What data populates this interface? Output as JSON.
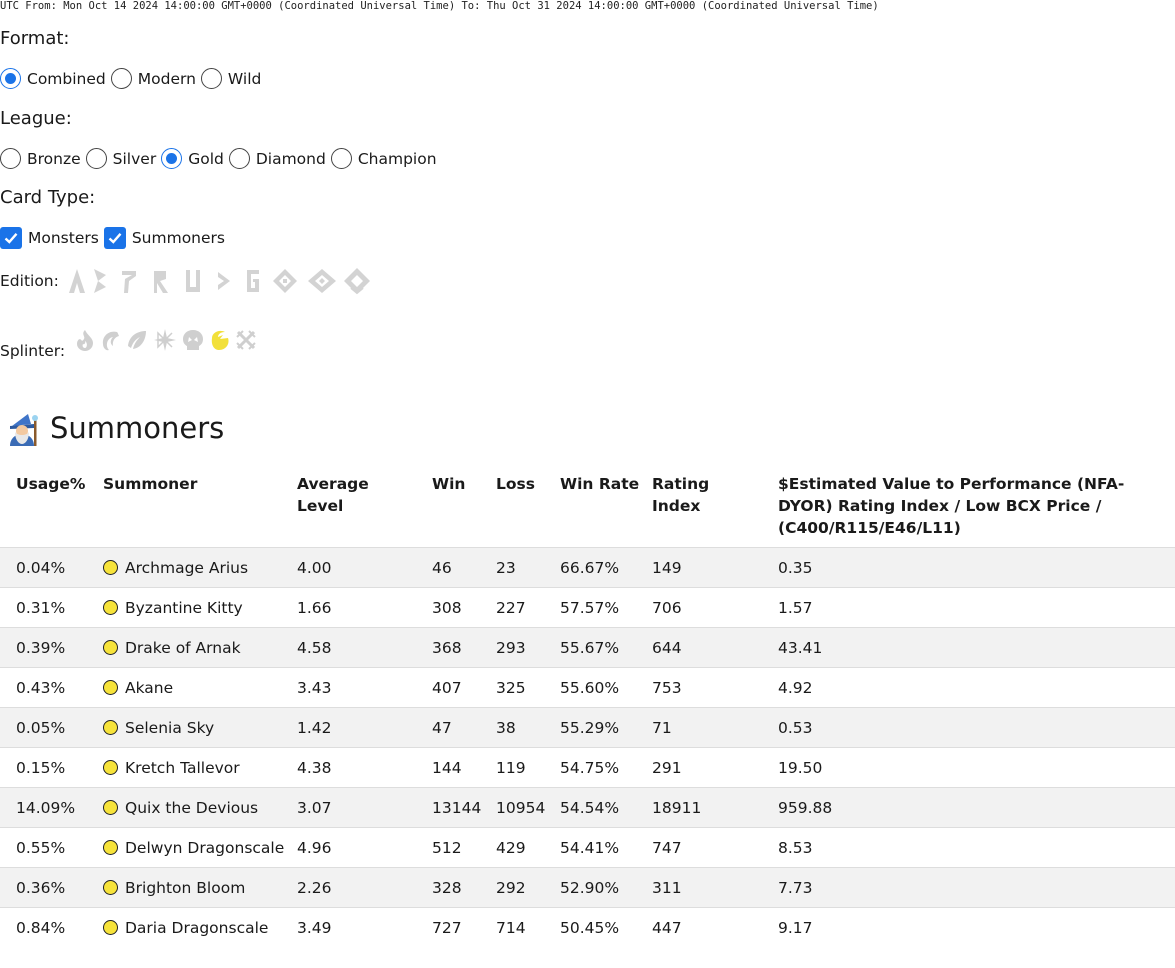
{
  "utc_range": "UTC From: Mon Oct 14 2024 14:00:00 GMT+0000 (Coordinated Universal Time) To: Thu Oct 31 2024 14:00:00 GMT+0000 (Coordinated Universal Time)",
  "format": {
    "label": "Format:",
    "options": [
      {
        "label": "Combined",
        "checked": true
      },
      {
        "label": "Modern",
        "checked": false
      },
      {
        "label": "Wild",
        "checked": false
      }
    ]
  },
  "league": {
    "label": "League:",
    "options": [
      {
        "label": "Bronze",
        "checked": false
      },
      {
        "label": "Silver",
        "checked": false
      },
      {
        "label": "Gold",
        "checked": true
      },
      {
        "label": "Diamond",
        "checked": false
      },
      {
        "label": "Champion",
        "checked": false
      }
    ]
  },
  "card_type": {
    "label": "Card Type:",
    "options": [
      {
        "label": "Monsters",
        "checked": true
      },
      {
        "label": "Summoners",
        "checked": true
      }
    ]
  },
  "edition": {
    "label": "Edition:",
    "icons": [
      "alpha-icon",
      "beta-icon",
      "promo-icon",
      "reward-icon",
      "untamed-icon",
      "dice-icon",
      "gladius-icon",
      "chaos-icon",
      "rift-icon",
      "rebellion-icon"
    ]
  },
  "splinter": {
    "label": "Splinter:",
    "icons": [
      "fire-icon",
      "water-icon",
      "earth-icon",
      "life-icon",
      "death-icon",
      "dragon-icon",
      "neutral-icon"
    ],
    "active": "dragon-icon",
    "active_color": "#f2e03a",
    "inactive_color": "#cfcfcf"
  },
  "section": {
    "title": "Summoners",
    "icon": "wizard-icon"
  },
  "table": {
    "headers": [
      "Usage%",
      "Summoner",
      "Average Level",
      "Win",
      "Loss",
      "Win Rate",
      "Rating Index",
      "$Estimated Value to Performance (NFA-DYOR) Rating Index / Low BCX Price / (C400/R115/E46/L11)"
    ],
    "rows": [
      [
        "0.04%",
        "Archmage Arius",
        "4.00",
        "46",
        "23",
        "66.67%",
        "149",
        "0.35"
      ],
      [
        "0.31%",
        "Byzantine Kitty",
        "1.66",
        "308",
        "227",
        "57.57%",
        "706",
        "1.57"
      ],
      [
        "0.39%",
        "Drake of Arnak",
        "4.58",
        "368",
        "293",
        "55.67%",
        "644",
        "43.41"
      ],
      [
        "0.43%",
        "Akane",
        "3.43",
        "407",
        "325",
        "55.60%",
        "753",
        "4.92"
      ],
      [
        "0.05%",
        "Selenia Sky",
        "1.42",
        "47",
        "38",
        "55.29%",
        "71",
        "0.53"
      ],
      [
        "0.15%",
        "Kretch Tallevor",
        "4.38",
        "144",
        "119",
        "54.75%",
        "291",
        "19.50"
      ],
      [
        "14.09%",
        "Quix the Devious",
        "3.07",
        "13144",
        "10954",
        "54.54%",
        "18911",
        "959.88"
      ],
      [
        "0.55%",
        "Delwyn Dragonscale",
        "4.96",
        "512",
        "429",
        "54.41%",
        "747",
        "8.53"
      ],
      [
        "0.36%",
        "Brighton Bloom",
        "2.26",
        "328",
        "292",
        "52.90%",
        "311",
        "7.73"
      ],
      [
        "0.84%",
        "Daria Dragonscale",
        "3.49",
        "727",
        "714",
        "50.45%",
        "447",
        "9.17"
      ]
    ]
  }
}
